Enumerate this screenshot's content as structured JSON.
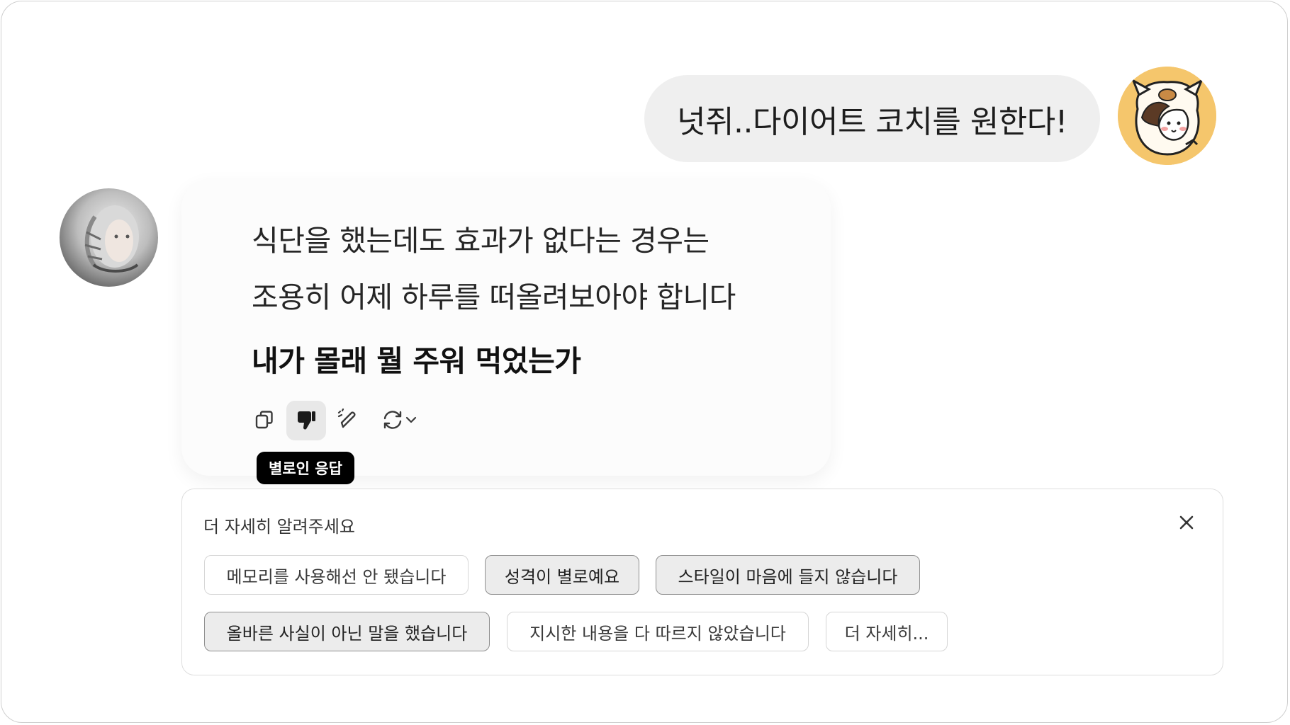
{
  "conversation": {
    "user_message": "넛쥐..다이어트 코치를 원한다!",
    "assistant_lines": [
      "식단을 했는데도 효과가 없다는 경우는",
      "조용히 어제 하루를 떠올려보아야 합니다",
      "내가 몰래 뭘 주워 먹었는가"
    ]
  },
  "actions": {
    "icons": [
      "copy-icon",
      "thumbs-down-icon",
      "edit-icon",
      "regenerate-icon",
      "chevron-down-icon"
    ],
    "tooltip": "별로인 응답"
  },
  "feedback": {
    "title": "더 자세히 알려주세요",
    "chips": [
      {
        "label": "메모리를 사용해선 안 됐습니다",
        "selected": false
      },
      {
        "label": "성격이 별로예요",
        "selected": true
      },
      {
        "label": "스타일이 마음에 들지 않습니다",
        "selected": true
      },
      {
        "label": "올바른 사실이 아닌 말을 했습니다",
        "selected": true
      },
      {
        "label": "지시한 내용을 다 따르지 않았습니다",
        "selected": false
      },
      {
        "label": "더 자세히...",
        "selected": false
      }
    ]
  },
  "colors": {
    "user_bubble": "#efefef",
    "user_avatar_bg": "#f5c66c",
    "tooltip_bg": "#000000",
    "chip_selected_bg": "#ececec"
  }
}
